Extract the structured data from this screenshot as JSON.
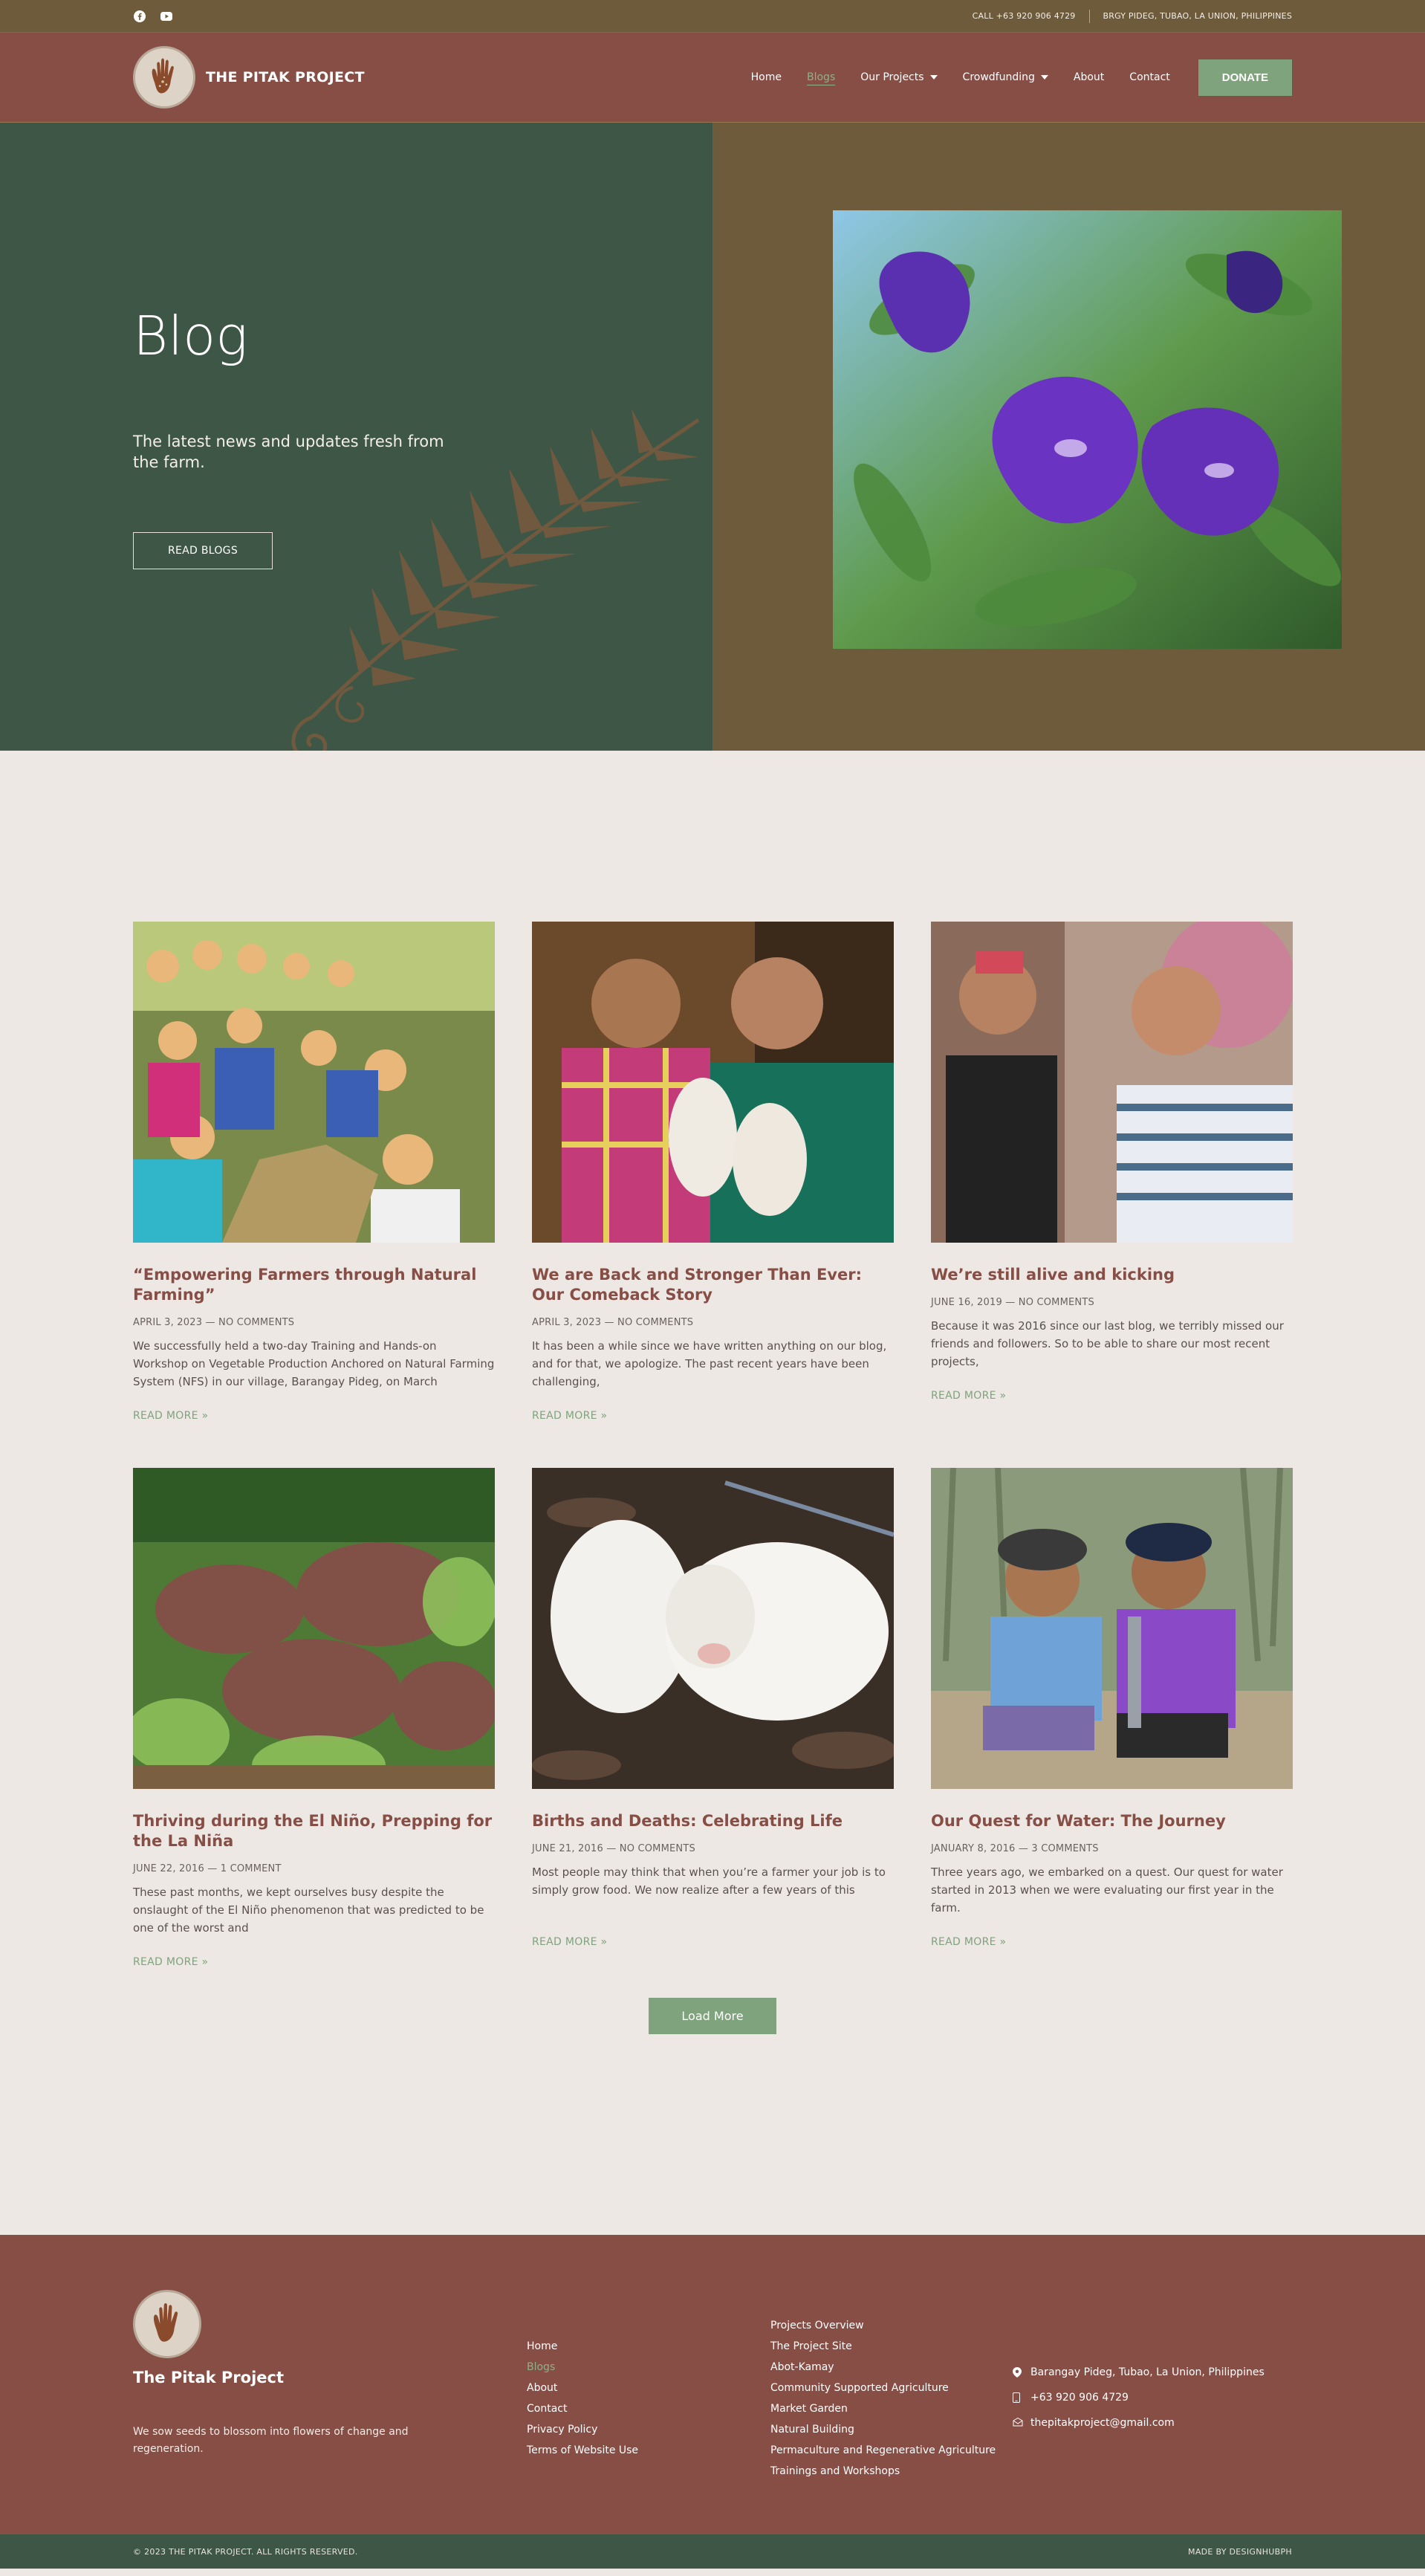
{
  "topbar": {
    "social": [
      {
        "icon": "facebook-icon"
      },
      {
        "icon": "youtube-icon"
      }
    ],
    "phone": "CALL +63 920 906 4729",
    "address": "BRGY PIDEG, TUBAO, LA UNION, PHILIPPINES"
  },
  "header": {
    "brand": "THE PITAK PROJECT",
    "nav": [
      {
        "label": "Home"
      },
      {
        "label": "Blogs",
        "active": true
      },
      {
        "label": "Our Projects",
        "dropdown": true
      },
      {
        "label": "Crowdfunding",
        "dropdown": true
      },
      {
        "label": "About"
      },
      {
        "label": "Contact"
      }
    ],
    "donate": "DONATE"
  },
  "hero": {
    "title": "Blog",
    "subtitle": "The latest news and updates fresh from the farm.",
    "button": "READ BLOGS"
  },
  "posts": [
    {
      "title": "“Empowering Farmers through Natural Farming”",
      "meta": "APRIL 3, 2023 — NO COMMENTS",
      "excerpt": "We successfully held a two-day Training and Hands-on Workshop on Vegetable Production Anchored on Natural Farming System (NFS) in our village, Barangay Pideg, on March",
      "more": "READ MORE »"
    },
    {
      "title": "We are Back and Stronger Than Ever: Our Comeback Story",
      "meta": "APRIL 3, 2023 — NO COMMENTS",
      "excerpt": "It has been a while since we have written anything on our blog, and for that, we apologize. The past recent years have been challenging,",
      "more": "READ MORE »"
    },
    {
      "title": "We’re still alive and kicking",
      "meta": "JUNE 16, 2019 — NO COMMENTS",
      "excerpt": "Because it was 2016 since our last blog, we terribly missed our friends and followers. So to be able to share our most recent projects,",
      "more": "READ MORE »"
    },
    {
      "title": "Thriving during the El Niño, Prepping for the La Niña",
      "meta": "JUNE 22, 2016 — 1 COMMENT",
      "excerpt": "These past months, we kept ourselves busy despite the onslaught of the El Niño phenomenon that was predicted to be one of the worst and",
      "more": "READ MORE »"
    },
    {
      "title": "Births and Deaths: Celebrating Life",
      "meta": "JUNE 21, 2016 — NO COMMENTS",
      "excerpt": "Most people may think that when you’re a farmer your job is to simply grow food. We now realize after a few years of this",
      "more": "READ MORE »"
    },
    {
      "title": "Our Quest for Water: The Journey",
      "meta": "JANUARY 8, 2016 — 3 COMMENTS",
      "excerpt": "Three years ago, we embarked on a quest. Our quest for water started in 2013 when we were evaluating our first year in the farm.",
      "more": "READ MORE »"
    }
  ],
  "load_more": "Load More",
  "footer": {
    "name": "The Pitak Project",
    "tagline": "We sow seeds to blossom into flowers of change and regeneration.",
    "links": [
      {
        "label": "Home"
      },
      {
        "label": "Blogs",
        "active": true
      },
      {
        "label": "About"
      },
      {
        "label": "Contact"
      },
      {
        "label": "Privacy Policy"
      },
      {
        "label": "Terms of Website Use"
      }
    ],
    "projects": [
      "Projects Overview",
      "The Project Site",
      "Abot-Kamay",
      "Community Supported Agriculture",
      "Market Garden",
      "Natural Building",
      "Permaculture and Regenerative Agriculture",
      "Trainings and Workshops"
    ],
    "contact": {
      "address": "Barangay Pideg, Tubao, La Union, Philippines",
      "phone": "+63 920 906 4729",
      "email": "thepitakproject@gmail.com"
    },
    "copyright": "© 2023 THE PITAK PROJECT. ALL RIGHTS RESERVED.",
    "credit": "MADE BY DESIGNHUBPH"
  },
  "colors": {
    "topbar": "#6d5b3b",
    "header": "#874e46",
    "hero_left": "#3e5645",
    "accent": "#7fa37c",
    "page_bg": "#eee8e5"
  }
}
